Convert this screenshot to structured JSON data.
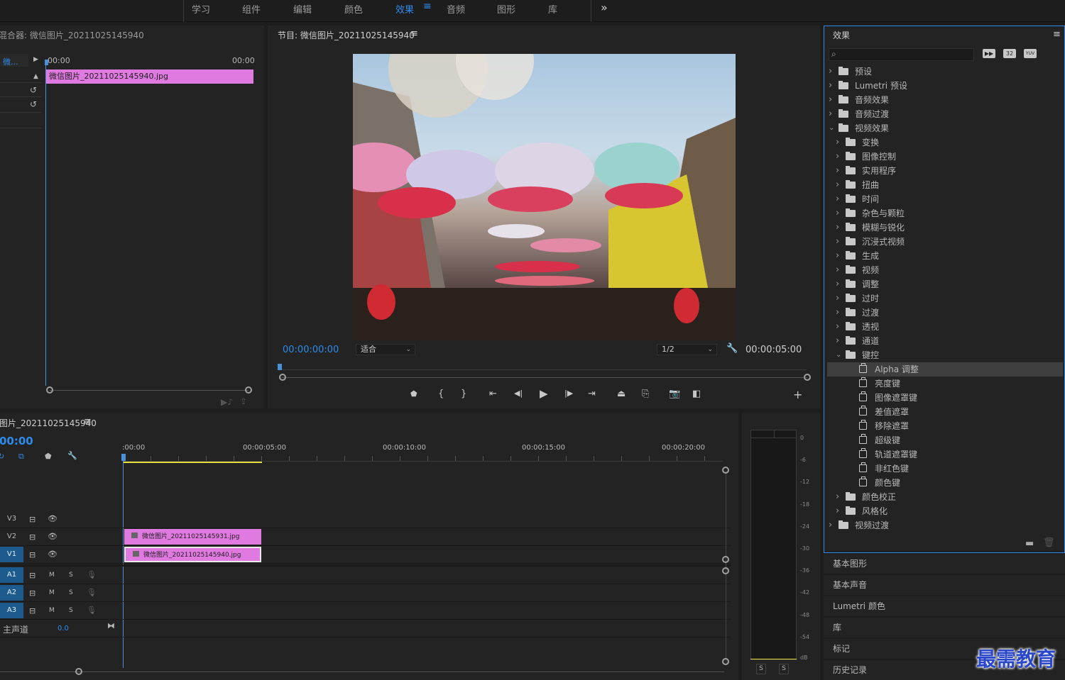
{
  "workspace": {
    "tabs": [
      "学习",
      "组件",
      "编辑",
      "颜色",
      "效果",
      "音频",
      "图形",
      "库"
    ],
    "active": "效果",
    "more": "»"
  },
  "source": {
    "title": "混合器: 微信图片_20211025145940",
    "track_label": "微...",
    "tc_start": "00:00",
    "tc_end": "00:00",
    "clip": "微信图片_20211025145940.jpg"
  },
  "program": {
    "title": "节目: 微信图片_20211025145940",
    "timecode": "00:00:00:00",
    "fit": "适合",
    "quality": "1/2",
    "duration": "00:00:05:00"
  },
  "timeline": {
    "title": "图片_20211025145940",
    "timecode": "00:00",
    "ruler": ":00:00",
    "ticks": [
      "00:00:05:00",
      "00:00:10:00",
      "00:00:15:00",
      "00:00:20:00"
    ],
    "video_tracks": [
      "V3",
      "V2",
      "V1"
    ],
    "audio_tracks": [
      "A1",
      "A2",
      "A3"
    ],
    "mute": "M",
    "solo": "S",
    "master": "主声道",
    "master_value": "0.0",
    "clip_v2": "微信图片_20211025145931.jpg",
    "clip_v1": "微信图片_20211025145940.jpg"
  },
  "meter": {
    "db": [
      "0",
      "-6",
      "-12",
      "-18",
      "-24",
      "-30",
      "-36",
      "-42",
      "-48",
      "-54",
      "dB"
    ],
    "solo": [
      "S",
      "S"
    ]
  },
  "effects": {
    "title": "效果",
    "badge_32": "32",
    "badge_yuv": "YUV",
    "items": [
      {
        "label": "预设",
        "level": 0,
        "type": "preset",
        "open": false
      },
      {
        "label": "Lumetri 预设",
        "level": 0,
        "type": "preset",
        "open": false
      },
      {
        "label": "音频效果",
        "level": 0,
        "type": "folder",
        "open": false
      },
      {
        "label": "音频过渡",
        "level": 0,
        "type": "folder",
        "open": false
      },
      {
        "label": "视频效果",
        "level": 0,
        "type": "folder",
        "open": true
      },
      {
        "label": "变换",
        "level": 1,
        "type": "folder",
        "open": false
      },
      {
        "label": "图像控制",
        "level": 1,
        "type": "folder",
        "open": false
      },
      {
        "label": "实用程序",
        "level": 1,
        "type": "folder",
        "open": false
      },
      {
        "label": "扭曲",
        "level": 1,
        "type": "folder",
        "open": false
      },
      {
        "label": "时间",
        "level": 1,
        "type": "folder",
        "open": false
      },
      {
        "label": "杂色与颗粒",
        "level": 1,
        "type": "folder",
        "open": false
      },
      {
        "label": "模糊与锐化",
        "level": 1,
        "type": "folder",
        "open": false
      },
      {
        "label": "沉浸式视频",
        "level": 1,
        "type": "folder",
        "open": false
      },
      {
        "label": "生成",
        "level": 1,
        "type": "folder",
        "open": false
      },
      {
        "label": "视频",
        "level": 1,
        "type": "folder",
        "open": false
      },
      {
        "label": "调整",
        "level": 1,
        "type": "folder",
        "open": false
      },
      {
        "label": "过时",
        "level": 1,
        "type": "folder",
        "open": false
      },
      {
        "label": "过渡",
        "level": 1,
        "type": "folder",
        "open": false
      },
      {
        "label": "透视",
        "level": 1,
        "type": "folder",
        "open": false
      },
      {
        "label": "通道",
        "level": 1,
        "type": "folder",
        "open": false
      },
      {
        "label": "键控",
        "level": 1,
        "type": "folder",
        "open": true
      },
      {
        "label": "Alpha 调整",
        "level": 2,
        "type": "effect",
        "highlight": true
      },
      {
        "label": "亮度键",
        "level": 2,
        "type": "effect"
      },
      {
        "label": "图像遮罩键",
        "level": 2,
        "type": "effect"
      },
      {
        "label": "差值遮罩",
        "level": 2,
        "type": "effect"
      },
      {
        "label": "移除遮罩",
        "level": 2,
        "type": "effect"
      },
      {
        "label": "超级键",
        "level": 2,
        "type": "effect"
      },
      {
        "label": "轨道遮罩键",
        "level": 2,
        "type": "effect"
      },
      {
        "label": "非红色键",
        "level": 2,
        "type": "effect"
      },
      {
        "label": "颜色键",
        "level": 2,
        "type": "effect"
      },
      {
        "label": "颜色校正",
        "level": 1,
        "type": "folder",
        "open": false
      },
      {
        "label": "风格化",
        "level": 1,
        "type": "folder",
        "open": false
      },
      {
        "label": "视频过渡",
        "level": 0,
        "type": "folder",
        "open": false
      }
    ]
  },
  "side_panels": [
    "基本图形",
    "基本声音",
    "Lumetri 颜色",
    "库",
    "标记",
    "历史记录"
  ],
  "watermark": "最需教育",
  "colors": {
    "accent": "#2d8ceb",
    "clip": "#e07ae0",
    "playhead": "#4a90d9",
    "workarea": "#e6e03a"
  }
}
